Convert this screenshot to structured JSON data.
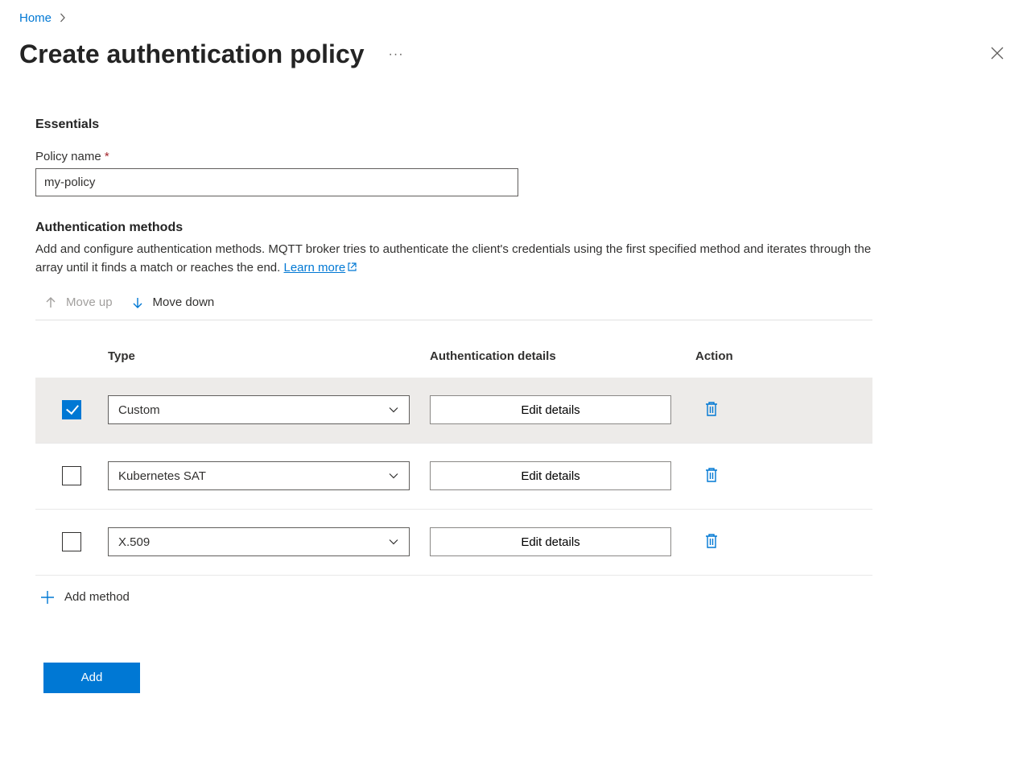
{
  "breadcrumb": {
    "home": "Home"
  },
  "page_title": "Create authentication policy",
  "essentials": {
    "heading": "Essentials",
    "policy_name_label": "Policy name",
    "policy_name_value": "my-policy"
  },
  "methods": {
    "heading": "Authentication methods",
    "description_pre": "Add and configure authentication methods. MQTT broker tries to authenticate the client's credentials using the first specified method and iterates through the array until it finds a match or reaches the end. ",
    "learn_more": "Learn more",
    "move_up": "Move up",
    "move_down": "Move down",
    "columns": {
      "type": "Type",
      "details": "Authentication details",
      "action": "Action"
    },
    "edit_label": "Edit details",
    "rows": [
      {
        "selected": true,
        "type": "Custom"
      },
      {
        "selected": false,
        "type": "Kubernetes SAT"
      },
      {
        "selected": false,
        "type": "X.509"
      }
    ],
    "add_method": "Add method"
  },
  "footer": {
    "add": "Add"
  }
}
